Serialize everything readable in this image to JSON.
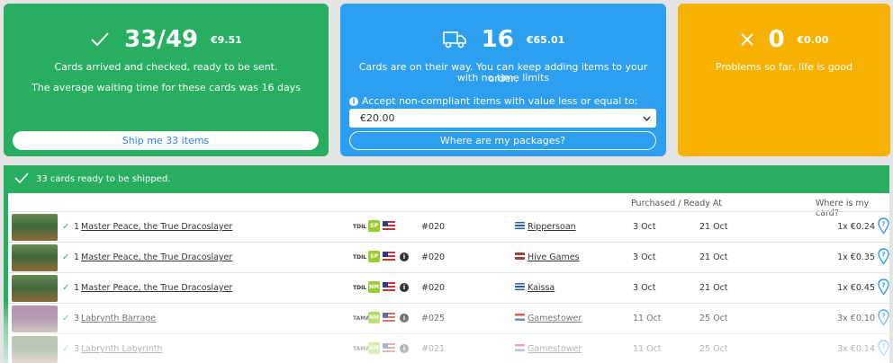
{
  "cards": {
    "arrived": {
      "count": "33/49",
      "amount": "€9.51",
      "line1": "Cards arrived and checked, ready to be sent.",
      "line2": "The average waiting time for these cards was 16 days",
      "button": "Ship me 33 items",
      "icon": "checkmark-icon",
      "color": "#27ae60"
    },
    "in_transit": {
      "count": "16",
      "amount": "€65.01",
      "line1": "Cards are on their way. You can keep adding items to your order,",
      "line2": "with no time limits",
      "noncompliant_label": "Accept non-compliant items with value less or equal to:",
      "select_value": "€20.00",
      "button": "Where are my packages?",
      "icon": "truck-icon",
      "color": "#2d9ff0"
    },
    "problems": {
      "count": "0",
      "amount": "€0.00",
      "line1": "Problems so far, life is good",
      "icon": "x-icon",
      "color": "#f7b100"
    }
  },
  "banner": {
    "text": "33 cards ready to be shipped.",
    "icon": "checkmark-icon"
  },
  "table": {
    "headers": {
      "purchased_ready": "Purchased / Ready At",
      "where": "Where is my card?"
    },
    "rows": [
      {
        "qty": "1",
        "name": "Master Peace, the True Dracoslayer",
        "set": "TDIL",
        "cond": "SP",
        "num": "#020",
        "flag": "gr",
        "seller": "Rippersoan",
        "purchased": "3 Oct",
        "ready": "21 Oct",
        "price": "1x €0.24",
        "note": false,
        "thumb": "green"
      },
      {
        "qty": "1",
        "name": "Master Peace, the True Dracoslayer",
        "set": "TDIL",
        "cond": "SP",
        "num": "#020",
        "flag": "lv",
        "seller": "Hive Games",
        "purchased": "3 Oct",
        "ready": "21 Oct",
        "price": "1x €0.35",
        "note": true,
        "thumb": "green"
      },
      {
        "qty": "1",
        "name": "Master Peace, the True Dracoslayer",
        "set": "TDIL",
        "cond": "NM",
        "num": "#020",
        "flag": "gr",
        "seller": "Kaissa",
        "purchased": "3 Oct",
        "ready": "21 Oct",
        "price": "1x €0.45",
        "note": true,
        "thumb": "green"
      },
      {
        "qty": "3",
        "name": "Labrynth Barrage",
        "set": "TAMA",
        "cond": "NM",
        "num": "#025",
        "flag": "nl",
        "seller": "Gamestower",
        "purchased": "11 Oct",
        "ready": "25 Oct",
        "price": "3x €0.10",
        "note": true,
        "thumb": "purple"
      },
      {
        "qty": "3",
        "name": "Labrynth Labyrinth",
        "set": "TAMA",
        "cond": "NM",
        "num": "#021",
        "flag": "nl",
        "seller": "Gamestower",
        "purchased": "11 Oct",
        "ready": "25 Oct",
        "price": "3x €0.14",
        "note": true,
        "thumb": "green"
      }
    ]
  }
}
